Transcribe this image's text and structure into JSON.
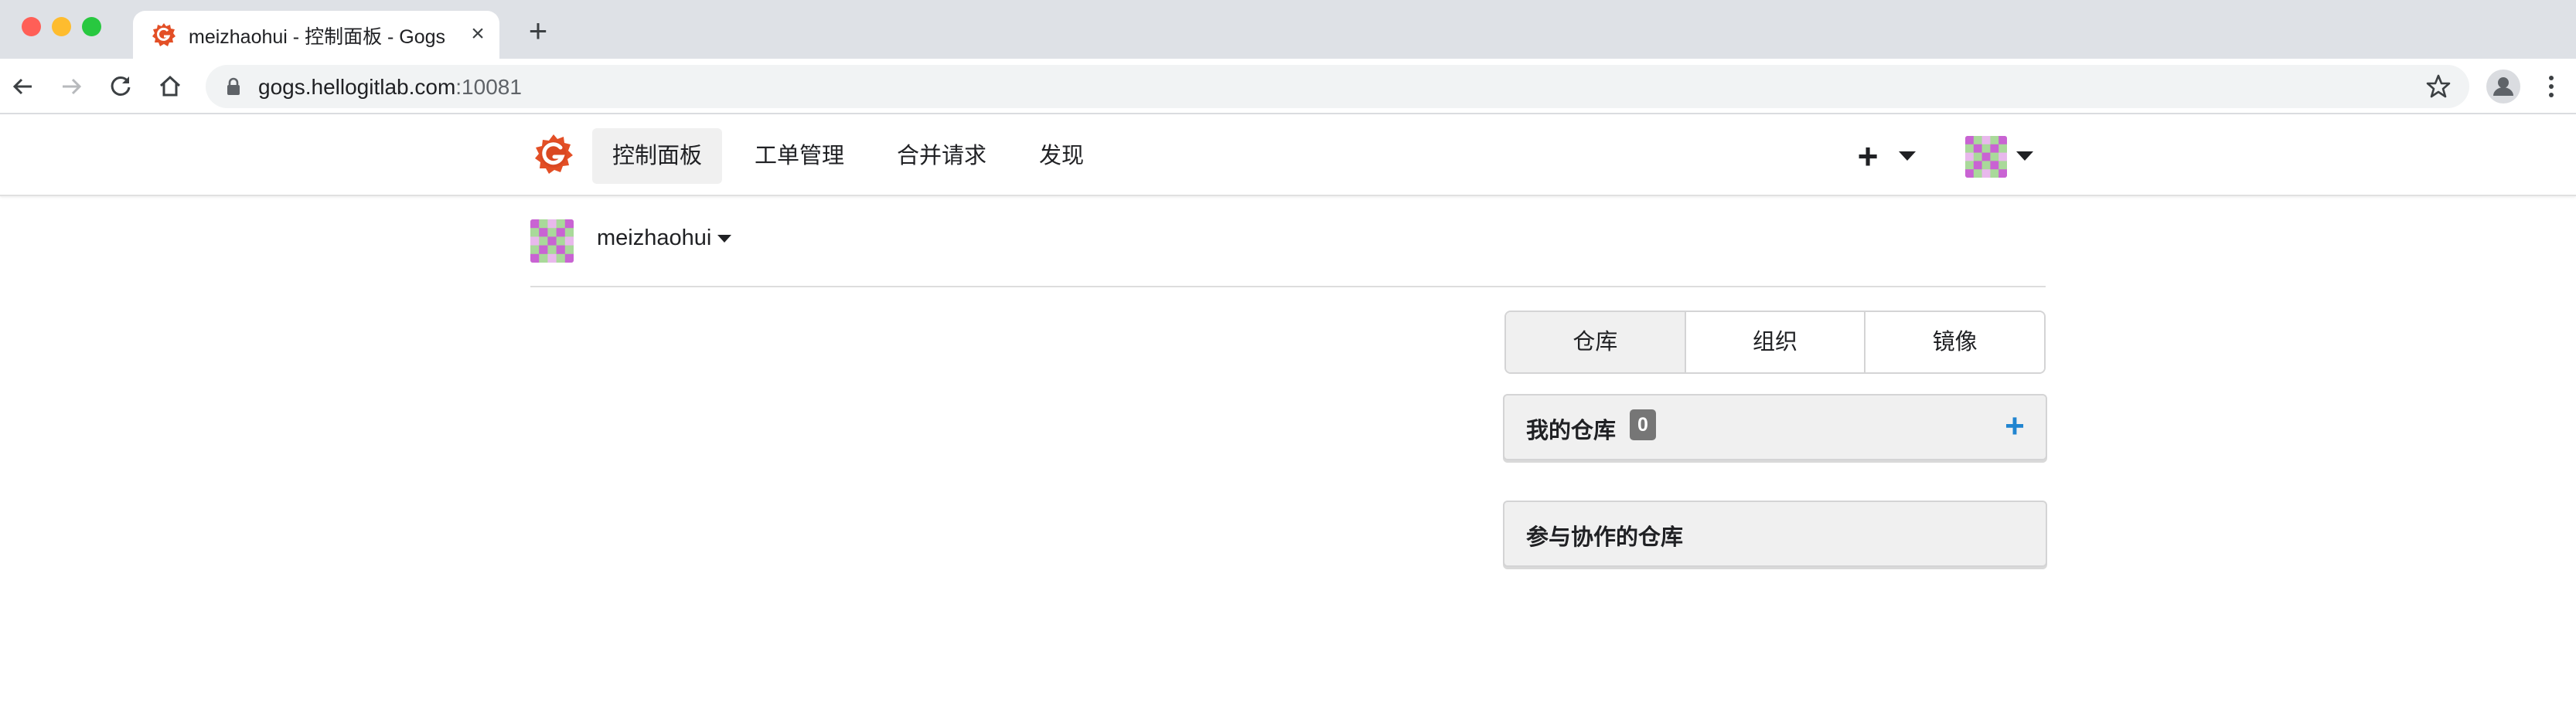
{
  "browser": {
    "tab": {
      "title": "meizhaohui - 控制面板 - Gogs",
      "close_glyph": "×"
    },
    "new_tab_glyph": "+",
    "url": {
      "host": "gogs.hellogitlab.com",
      "port": ":10081"
    },
    "icons": [
      "back-icon",
      "forward-icon",
      "reload-icon",
      "home-icon",
      "lock-icon",
      "bookmark-star-icon",
      "profile-icon",
      "kebab-menu-icon"
    ]
  },
  "navbar": {
    "items": [
      {
        "label": "控制面板",
        "active": true
      },
      {
        "label": "工单管理",
        "active": false
      },
      {
        "label": "合并请求",
        "active": false
      },
      {
        "label": "发现",
        "active": false
      }
    ],
    "create_glyph": "+"
  },
  "context": {
    "username": "meizhaohui"
  },
  "tabs": [
    {
      "label": "仓库",
      "active": true
    },
    {
      "label": "组织",
      "active": false
    },
    {
      "label": "镜像",
      "active": false
    }
  ],
  "my_repos": {
    "title": "我的仓库",
    "count": "0",
    "add_glyph": "+"
  },
  "collab_repos": {
    "title": "参与协作的仓库"
  },
  "colors": {
    "brand": "#e34f26",
    "accent": "#2185d0",
    "badge": "#767676",
    "avatar_pink": "#c963d3",
    "avatar_green": "#a9d99a"
  }
}
